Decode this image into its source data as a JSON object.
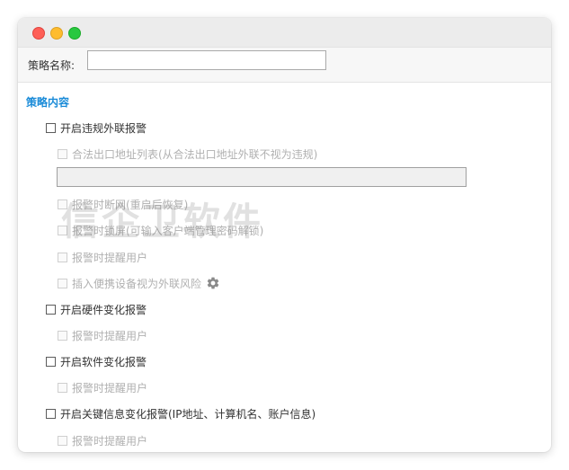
{
  "policy": {
    "name_label": "策略名称:",
    "name_value": ""
  },
  "section": {
    "title": "策略内容"
  },
  "options": {
    "violation": {
      "label": "开启违规外联报警",
      "checked": false
    },
    "legal_exit": {
      "label": "合法出口地址列表(从合法出口地址外联不视为违规)",
      "checked": false
    },
    "legal_exit_value": "",
    "disconnect": {
      "label": "报警时断网(重启后恢复)",
      "checked": false
    },
    "lock_screen": {
      "label": "报警时锁屏(可输入客户端管理密码解锁)",
      "checked": false
    },
    "notify_user_1": {
      "label": "报警时提醒用户",
      "checked": false
    },
    "portable_device": {
      "label": "插入便携设备视为外联风险",
      "checked": false
    },
    "hardware": {
      "label": "开启硬件变化报警",
      "checked": false
    },
    "notify_user_2": {
      "label": "报警时提醒用户",
      "checked": false
    },
    "software": {
      "label": "开启软件变化报警",
      "checked": false
    },
    "notify_user_3": {
      "label": "报警时提醒用户",
      "checked": false
    },
    "key_info": {
      "label": "开启关键信息变化报警(IP地址、计算机名、账户信息)",
      "checked": false
    },
    "notify_user_4": {
      "label": "报警时提醒用户",
      "checked": false
    }
  },
  "watermark": "信企卫软件",
  "icons": {
    "settings": "gear-icon"
  },
  "colors": {
    "section_title": "#1a8bd8",
    "close": "#fe5f57",
    "minimize": "#febc2e",
    "zoom": "#28c840"
  }
}
